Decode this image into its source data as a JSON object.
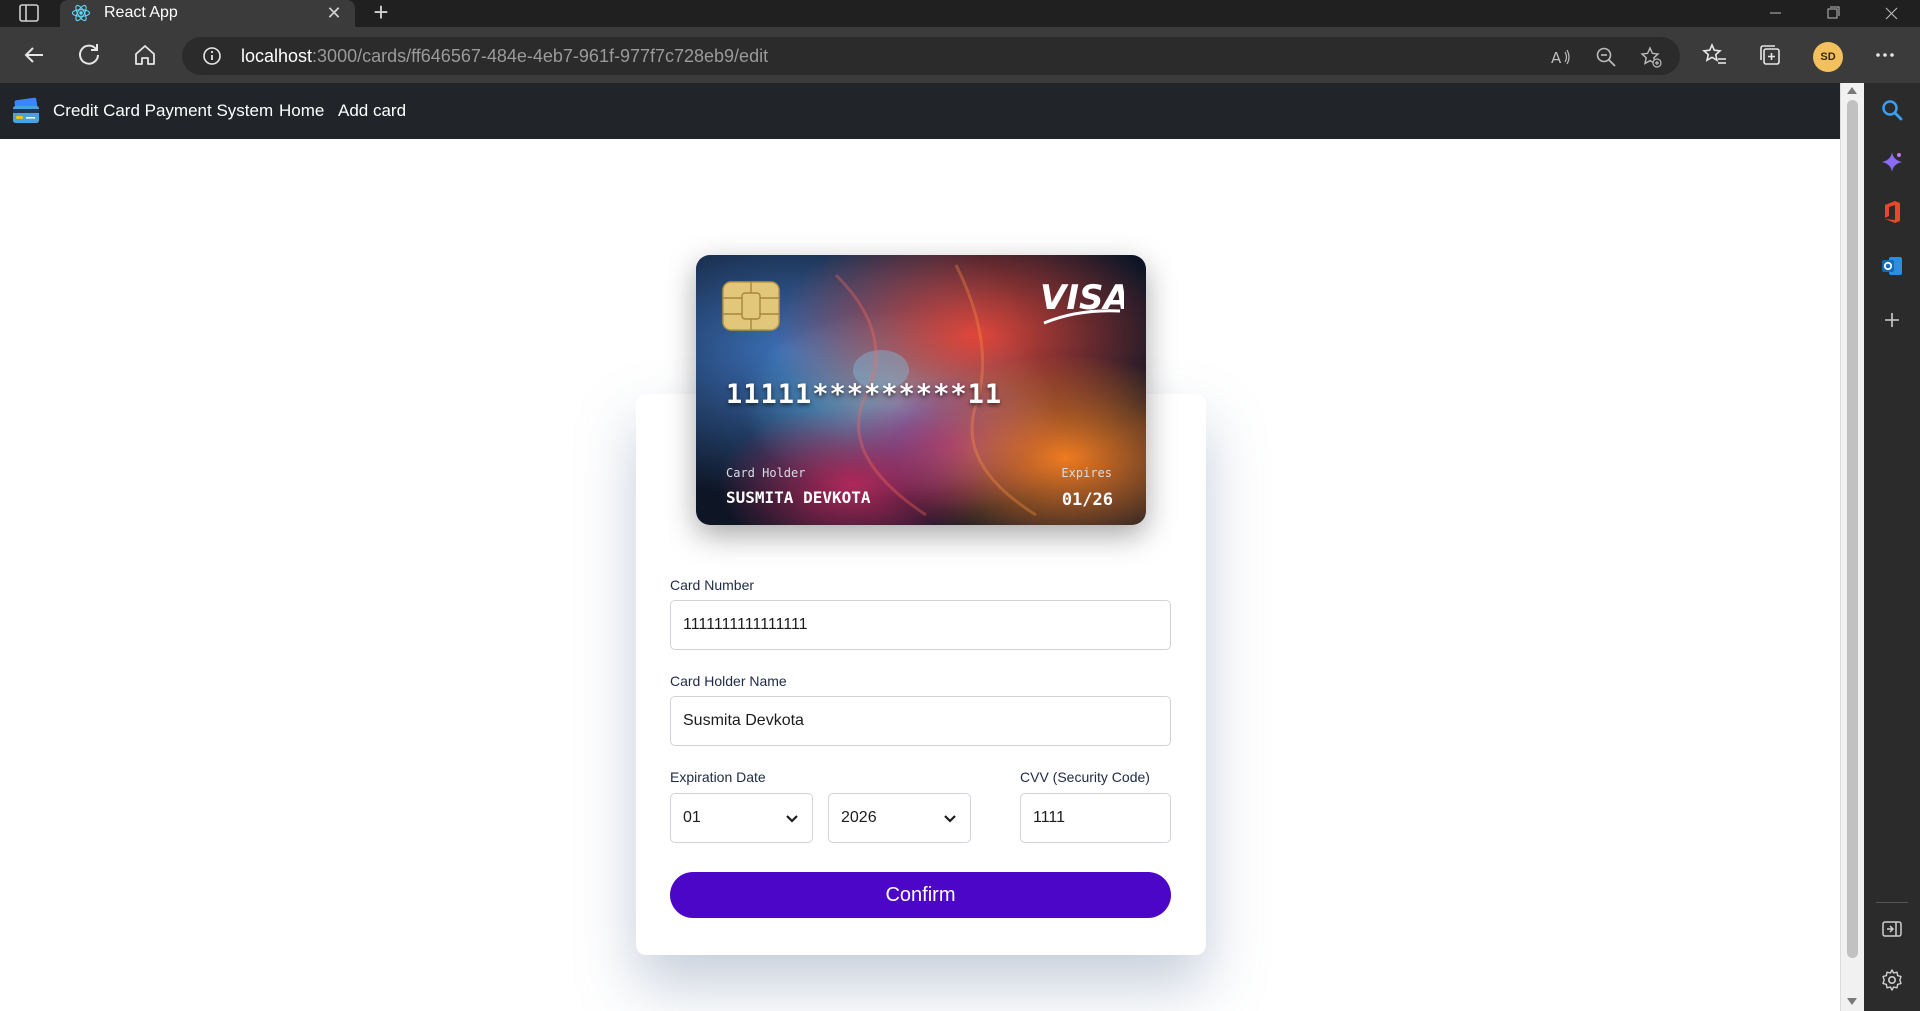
{
  "browser": {
    "tab_title": "React App",
    "url_host": "localhost",
    "url_path": ":3000/cards/ff646567-484e-4eb7-961f-977f7c728eb9/edit",
    "profile_initials": "SD"
  },
  "navbar": {
    "brand": "Credit Card Payment System",
    "links": [
      "Home",
      "Add card"
    ]
  },
  "card_preview": {
    "number": "11111*********11",
    "holder_label": "Card Holder",
    "holder_name": "SUSMITA DEVKOTA",
    "expires_label": "Expires",
    "expires": "01/26",
    "network": "VISA"
  },
  "form": {
    "card_number_label": "Card Number",
    "card_number_value": "1111111111111111",
    "holder_label": "Card Holder Name",
    "holder_value": "Susmita Devkota",
    "expiration_label": "Expiration Date",
    "month_value": "01",
    "year_value": "2026",
    "cvv_label": "CVV (Security Code)",
    "cvv_value": "1111",
    "confirm_label": "Confirm"
  },
  "colors": {
    "navbar_bg": "#212529",
    "accent": "#4b06c7",
    "chrome_bg": "#3b3b3b"
  }
}
